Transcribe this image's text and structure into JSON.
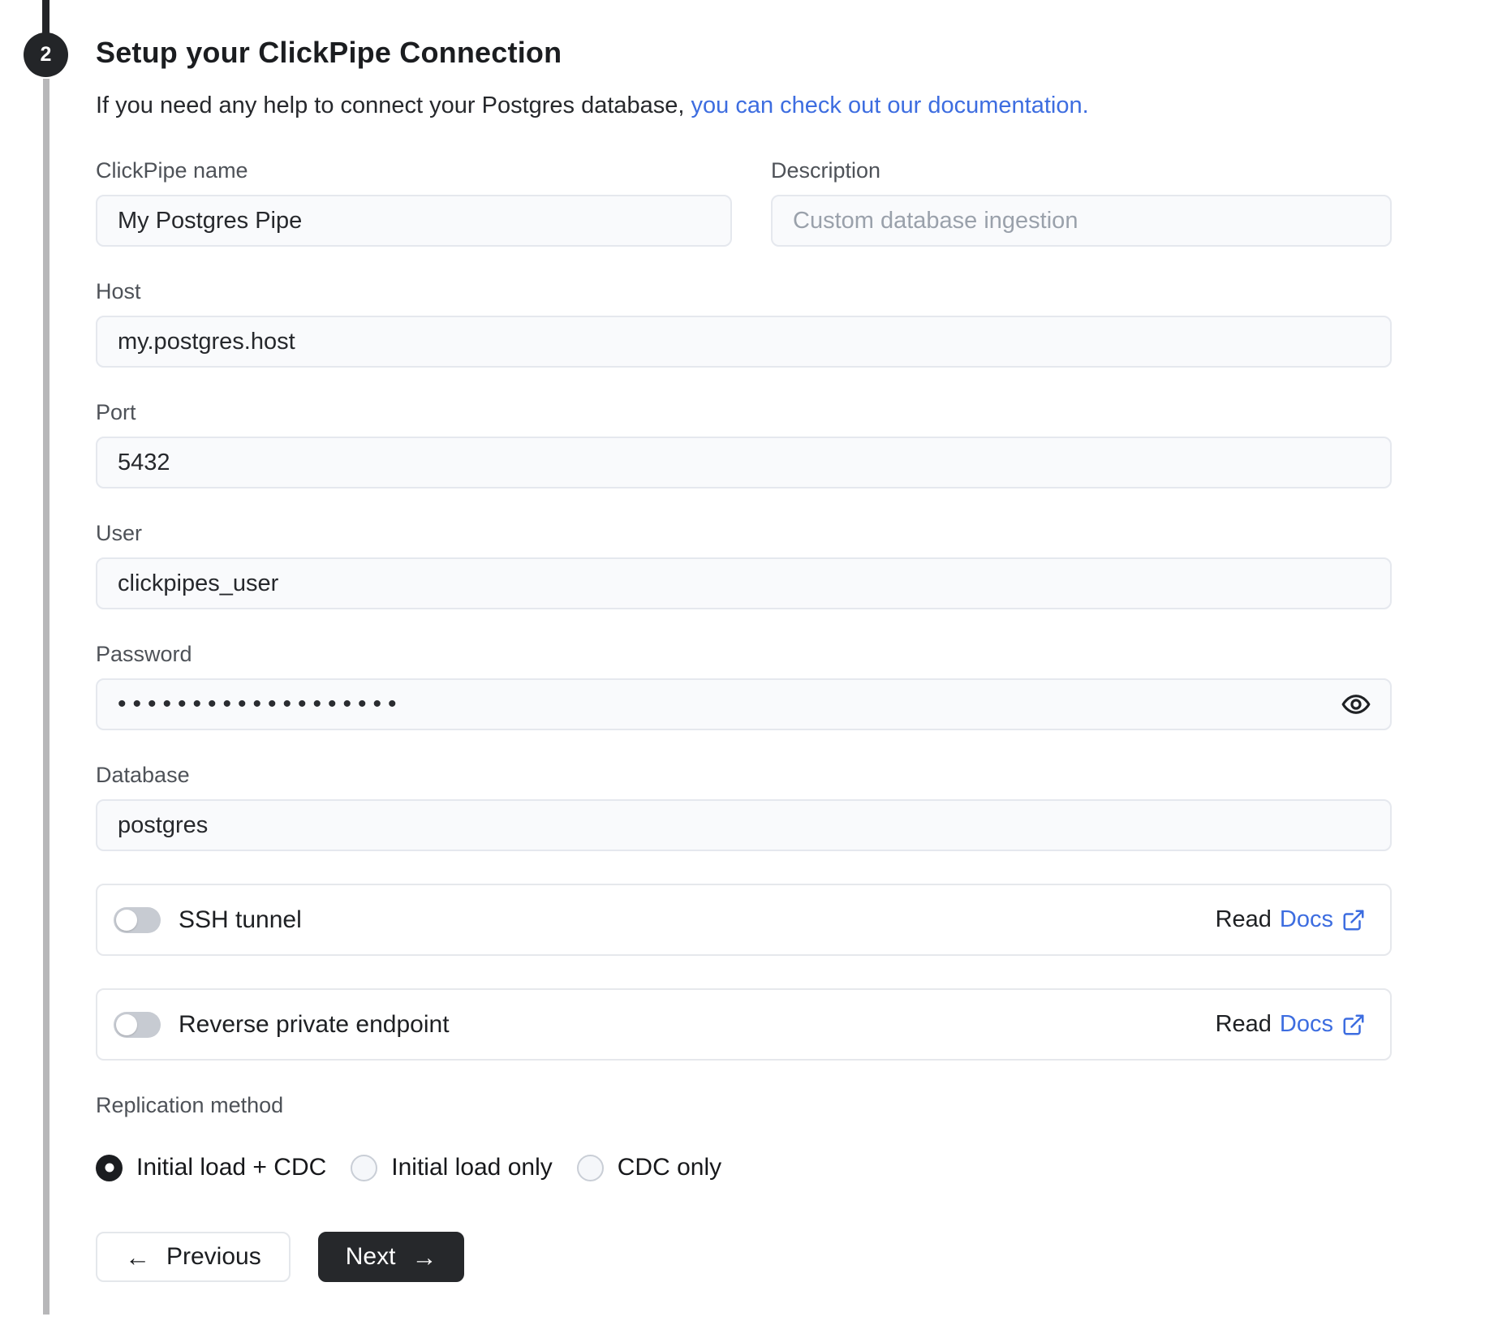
{
  "colors": {
    "link_blue": "#3d6de0",
    "dark": "#232528",
    "toggle_off_track": "#c7cbd2"
  },
  "stepper": {
    "step_number": "2"
  },
  "header": {
    "title": "Setup your ClickPipe Connection",
    "subtitle_plain": "If you need any help to connect your Postgres database, ",
    "subtitle_link": "you can check out our documentation."
  },
  "fields": {
    "clickpipe_name": {
      "label": "ClickPipe name",
      "value": "My Postgres Pipe"
    },
    "description": {
      "label": "Description",
      "placeholder": "Custom database ingestion"
    },
    "host": {
      "label": "Host",
      "value": "my.postgres.host"
    },
    "port": {
      "label": "Port",
      "value": "5432"
    },
    "user": {
      "label": "User",
      "value": "clickpipes_user"
    },
    "password": {
      "label": "Password",
      "masked_value": "•••••••••••••••••••"
    },
    "database": {
      "label": "Database",
      "value": "postgres"
    }
  },
  "toggles": [
    {
      "label": "SSH tunnel",
      "state": "off",
      "read_text": "Read",
      "docs_text": "Docs"
    },
    {
      "label": "Reverse private endpoint",
      "state": "off",
      "read_text": "Read",
      "docs_text": "Docs"
    }
  ],
  "replication": {
    "label": "Replication method",
    "options": [
      {
        "label": "Initial load + CDC",
        "selected": true
      },
      {
        "label": "Initial load only",
        "selected": false
      },
      {
        "label": "CDC only",
        "selected": false
      }
    ]
  },
  "actions": {
    "previous_label": "Previous",
    "next_label": "Next",
    "previous_arrow": "←",
    "next_arrow": "→"
  }
}
